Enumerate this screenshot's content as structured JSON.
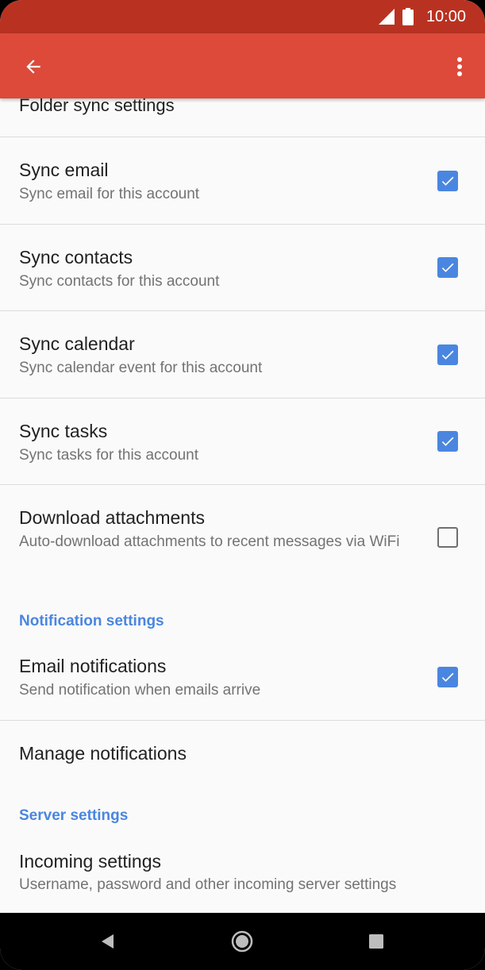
{
  "status_bar": {
    "time": "10:00"
  },
  "app_bar": {
    "back_icon": "arrow-back-icon",
    "menu_icon": "more-vert-icon"
  },
  "partial_header": "Folder sync settings",
  "sync_items": [
    {
      "title": "Sync email",
      "summary": "Sync email for this account",
      "checked": true
    },
    {
      "title": "Sync contacts",
      "summary": "Sync contacts for this account",
      "checked": true
    },
    {
      "title": "Sync calendar",
      "summary": "Sync calendar event for this account",
      "checked": true
    },
    {
      "title": "Sync tasks",
      "summary": "Sync tasks for this account",
      "checked": true
    },
    {
      "title": "Download attachments",
      "summary": "Auto-download attachments to recent messages via WiFi",
      "checked": false
    }
  ],
  "notification_section": {
    "header": "Notification settings",
    "email_notifications": {
      "title": "Email notifications",
      "summary": "Send notification when emails arrive",
      "checked": true
    },
    "manage_notifications": {
      "title": "Manage notifications"
    }
  },
  "server_section": {
    "header": "Server settings",
    "incoming": {
      "title": "Incoming settings",
      "summary": "Username, password and other incoming server settings"
    }
  },
  "colors": {
    "status_bar": "#b93221",
    "app_bar": "#dd4a3a",
    "accent": "#4a86e0"
  }
}
